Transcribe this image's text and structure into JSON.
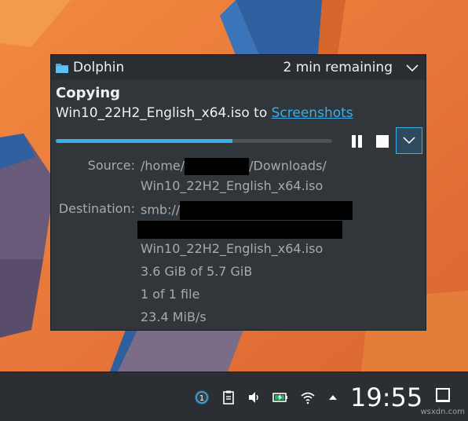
{
  "notification": {
    "app_name": "Dolphin",
    "remaining": "2 min remaining",
    "title": "Copying",
    "subline_prefix": "Win10_22H2_English_x64.iso to ",
    "destination_link": "Screenshots",
    "progress_fraction": 0.64,
    "source_label": "Source:",
    "source_prefix": "/home/",
    "source_suffix": "/Downloads/",
    "source_line2": "Win10_22H2_English_x64.iso",
    "destination_label": "Destination:",
    "destination_prefix": "smb://",
    "destination_line3": "Win10_22H2_English_x64.iso",
    "size_progress": "3.6 GiB of 5.7 GiB",
    "file_count": "1 of 1 file",
    "speed": "23.4 MiB/s"
  },
  "taskbar": {
    "notification_count": "1",
    "clock": "19:55"
  },
  "watermark": "wsxdn.com",
  "colors": {
    "accent": "#3daee9",
    "popup_bg": "#31363b",
    "taskbar_bg": "#2b2f33"
  }
}
